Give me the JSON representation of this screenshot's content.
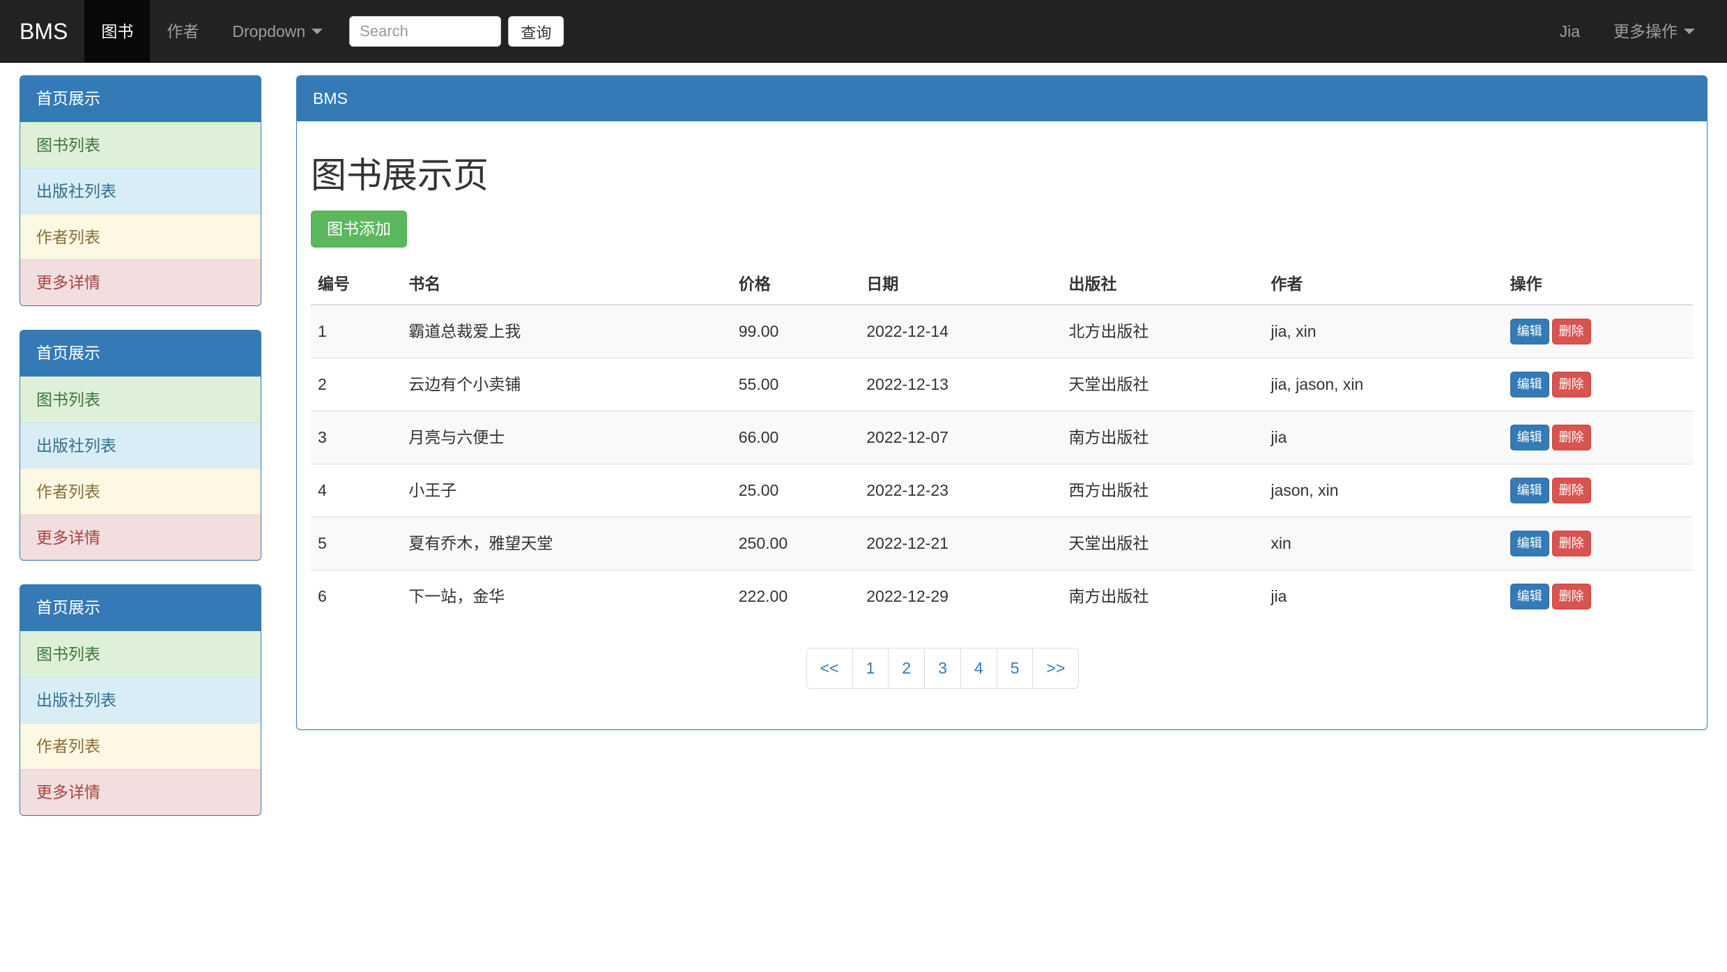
{
  "navbar": {
    "brand": "BMS",
    "items": [
      {
        "label": "图书",
        "active": true,
        "dropdown": false
      },
      {
        "label": "作者",
        "active": false,
        "dropdown": false
      },
      {
        "label": "Dropdown",
        "active": false,
        "dropdown": true
      }
    ],
    "search": {
      "value": "",
      "placeholder": "Search",
      "submit_label": "查询"
    },
    "right": {
      "user": "Jia",
      "more_label": "更多操作"
    }
  },
  "sidebar": {
    "panels": [
      {
        "heading": "首页展示",
        "items": [
          {
            "label": "图书列表",
            "style": "lg-success"
          },
          {
            "label": "出版社列表",
            "style": "lg-info"
          },
          {
            "label": "作者列表",
            "style": "lg-warning"
          },
          {
            "label": "更多详情",
            "style": "lg-danger"
          }
        ]
      },
      {
        "heading": "首页展示",
        "items": [
          {
            "label": "图书列表",
            "style": "lg-success"
          },
          {
            "label": "出版社列表",
            "style": "lg-info"
          },
          {
            "label": "作者列表",
            "style": "lg-warning"
          },
          {
            "label": "更多详情",
            "style": "lg-danger"
          }
        ]
      },
      {
        "heading": "首页展示",
        "items": [
          {
            "label": "图书列表",
            "style": "lg-success"
          },
          {
            "label": "出版社列表",
            "style": "lg-info"
          },
          {
            "label": "作者列表",
            "style": "lg-warning"
          },
          {
            "label": "更多详情",
            "style": "lg-danger"
          }
        ]
      }
    ]
  },
  "main": {
    "panel_heading": "BMS",
    "page_title": "图书展示页",
    "add_button": "图书添加",
    "table": {
      "headers": [
        "编号",
        "书名",
        "价格",
        "日期",
        "出版社",
        "作者",
        "操作"
      ],
      "rows": [
        {
          "id": "1",
          "name": "霸道总裁爱上我",
          "price": "99.00",
          "date": "2022-12-14",
          "publisher": "北方出版社",
          "authors": "jia, xin",
          "edit": "编辑",
          "delete": "删除"
        },
        {
          "id": "2",
          "name": "云边有个小卖铺",
          "price": "55.00",
          "date": "2022-12-13",
          "publisher": "天堂出版社",
          "authors": "jia, jason, xin",
          "edit": "编辑",
          "delete": "删除"
        },
        {
          "id": "3",
          "name": "月亮与六便士",
          "price": "66.00",
          "date": "2022-12-07",
          "publisher": "南方出版社",
          "authors": "jia",
          "edit": "编辑",
          "delete": "删除"
        },
        {
          "id": "4",
          "name": "小王子",
          "price": "25.00",
          "date": "2022-12-23",
          "publisher": "西方出版社",
          "authors": "jason, xin",
          "edit": "编辑",
          "delete": "删除"
        },
        {
          "id": "5",
          "name": "夏有乔木，雅望天堂",
          "price": "250.00",
          "date": "2022-12-21",
          "publisher": "天堂出版社",
          "authors": "xin",
          "edit": "编辑",
          "delete": "删除"
        },
        {
          "id": "6",
          "name": "下一站，金华",
          "price": "222.00",
          "date": "2022-12-29",
          "publisher": "南方出版社",
          "authors": "jia",
          "edit": "编辑",
          "delete": "删除"
        }
      ]
    },
    "pagination": {
      "prev": "<<",
      "pages": [
        "1",
        "2",
        "3",
        "4",
        "5"
      ],
      "next": ">>",
      "active": null
    }
  },
  "colors": {
    "navbar_bg": "#222222",
    "navbar_active_bg": "#080808",
    "primary": "#337ab7",
    "success": "#5cb85c",
    "danger": "#d9534f",
    "link": "#337ab7"
  }
}
